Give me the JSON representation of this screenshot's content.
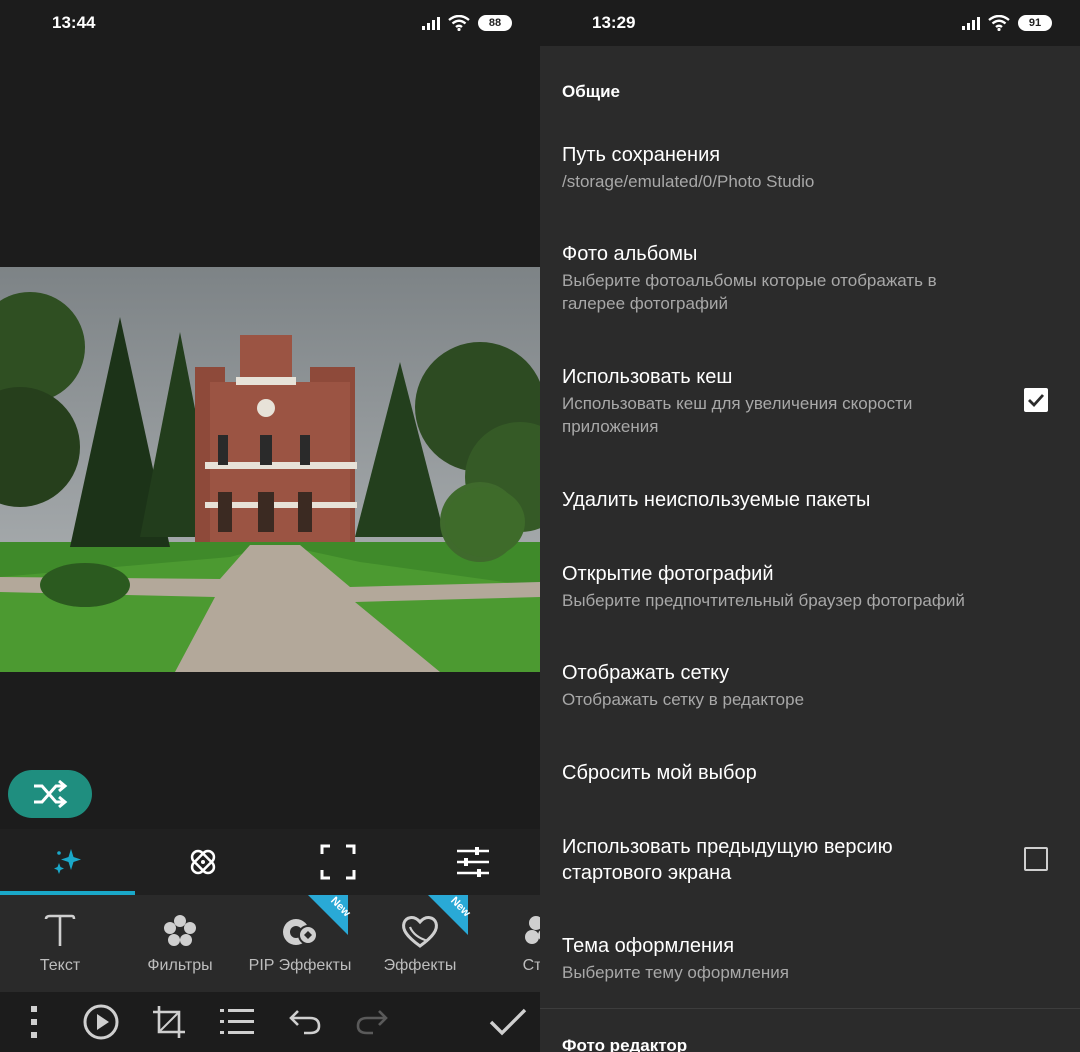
{
  "left": {
    "status": {
      "time": "13:44",
      "battery": "88"
    },
    "tabs": [
      {
        "icon": "sparkle-icon",
        "active": true
      },
      {
        "icon": "bandage-icon",
        "active": false
      },
      {
        "icon": "crop-frame-icon",
        "active": false
      },
      {
        "icon": "sliders-icon",
        "active": false
      }
    ],
    "tools": [
      {
        "label": "Текст",
        "icon": "text-icon",
        "new": false
      },
      {
        "label": "Фильтры",
        "icon": "flower-icon",
        "new": false
      },
      {
        "label": "PIP Эффекты",
        "icon": "pip-icon",
        "new": true,
        "badge": "New"
      },
      {
        "label": "Эффекты",
        "icon": "heart-icon",
        "new": true,
        "badge": "New"
      },
      {
        "label": "Стик",
        "icon": "sticker-icon",
        "new": false
      }
    ],
    "accent": "#1aa8c9",
    "shuffle_color": "#1f8e7f"
  },
  "right": {
    "status": {
      "time": "13:29",
      "battery": "91"
    },
    "section": "Общие",
    "items": [
      {
        "title": "Путь сохранения",
        "subtitle": "/storage/emulated/0/Photo Studio"
      },
      {
        "title": "Фото альбомы",
        "subtitle": "Выберите фотоальбомы которые отображать в галерее фотографий"
      },
      {
        "title": "Использовать кеш",
        "subtitle": "Использовать кеш для увеличения скорости приложения",
        "checkbox": true
      },
      {
        "title": "Удалить неиспользуемые пакеты"
      },
      {
        "title": "Открытие фотографий",
        "subtitle": "Выберите предпочтительный браузер фотографий"
      },
      {
        "title": "Отображать сетку",
        "subtitle": "Отображать сетку в редакторе"
      },
      {
        "title": "Сбросить мой выбор"
      },
      {
        "title": "Использовать предыдущую версию стартового экрана",
        "checkbox": false
      },
      {
        "title": "Тема оформления",
        "subtitle": "Выберите тему оформления"
      }
    ],
    "next_section": "Фото редактор"
  }
}
